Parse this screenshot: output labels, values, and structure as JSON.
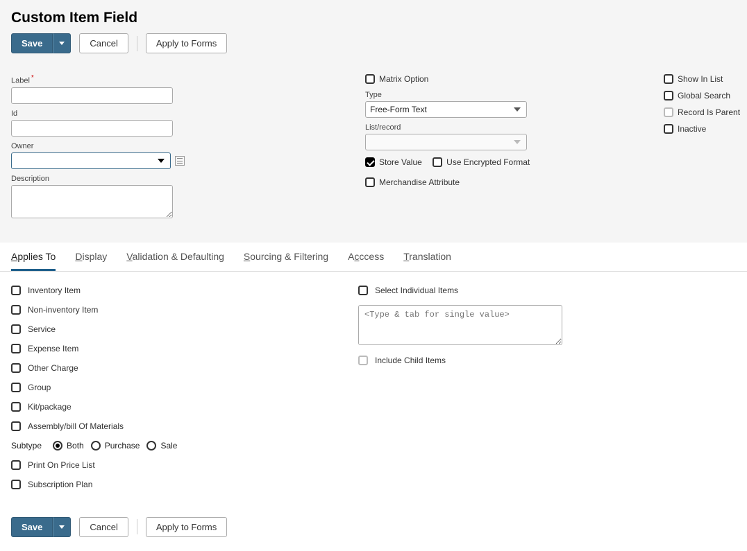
{
  "page": {
    "title": "Custom Item Field"
  },
  "toolbar": {
    "save": "Save",
    "cancel": "Cancel",
    "apply": "Apply to Forms"
  },
  "form": {
    "label_lbl": "Label",
    "label_val": "",
    "id_lbl": "Id",
    "id_val": "",
    "owner_lbl": "Owner",
    "owner_val": "",
    "desc_lbl": "Description",
    "desc_val": "",
    "matrix_option": "Matrix Option",
    "type_lbl": "Type",
    "type_val": "Free-Form Text",
    "listrecord_lbl": "List/record",
    "listrecord_val": "",
    "store_value": "Store Value",
    "encrypted": "Use Encrypted Format",
    "merch_attr": "Merchandise Attribute",
    "show_in_list": "Show In List",
    "global_search": "Global Search",
    "record_is_parent": "Record Is Parent",
    "inactive": "Inactive"
  },
  "tabs": {
    "applies_to": "pplies To",
    "display": "isplay",
    "validation": "alidation & Defaulting",
    "sourcing": "ourcing & Filtering",
    "access": "ccess",
    "translation": "ranslation"
  },
  "applies": {
    "inventory": "Inventory Item",
    "nonInventory": "Non-inventory Item",
    "service": "Service",
    "expense": "Expense Item",
    "otherCharge": "Other Charge",
    "group": "Group",
    "kit": "Kit/package",
    "assembly": "Assembly/bill Of Materials",
    "subtype_lbl": "Subtype",
    "both": "Both",
    "purchase": "Purchase",
    "sale": "Sale",
    "printPriceList": "Print On Price List",
    "subscription": "Subscription Plan",
    "selectIndividual": "Select Individual Items",
    "multi_placeholder": "<Type & tab for single value>",
    "includeChild": "Include Child Items"
  }
}
